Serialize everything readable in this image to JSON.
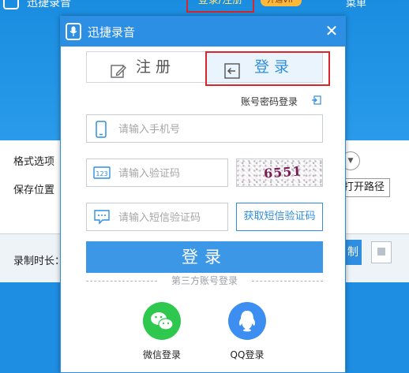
{
  "background_app": {
    "title": "迅捷录音",
    "login_register_link": "登录/注册",
    "vip_badge": "开通VIP",
    "menu_label": "菜单",
    "format_label": "格式选项",
    "save_location_label": "保存位置",
    "open_path_button": "打开路径",
    "record_duration_label": "录制时长：",
    "record_button": "制"
  },
  "dialog": {
    "title": "迅捷录音",
    "close_symbol": "✕",
    "tabs": {
      "register": "注册",
      "login": "登录"
    },
    "password_login_link": "账号密码登录",
    "phone": {
      "placeholder": "请输入手机号",
      "value": ""
    },
    "captcha": {
      "placeholder": "请输入验证码",
      "value": "",
      "image_text": "6551"
    },
    "sms": {
      "placeholder": "请输入短信验证码",
      "value": "",
      "button": "获取短信验证码"
    },
    "login_button": "登录",
    "third_party_label": "第三方账号登录",
    "social": {
      "wechat": "微信登录",
      "qq": "QQ登录"
    }
  },
  "colors": {
    "brand_blue": "#2c8fe4",
    "button_blue": "#3c97e6",
    "highlight_red": "#d8262c",
    "wechat_green": "#2dc84d",
    "qq_blue": "#3c8ef0"
  },
  "icons": [
    "microphone-icon",
    "close-icon",
    "edit-icon",
    "login-icon",
    "phone-icon",
    "captcha-123-icon",
    "sms-icon",
    "wechat-icon",
    "qq-icon"
  ]
}
